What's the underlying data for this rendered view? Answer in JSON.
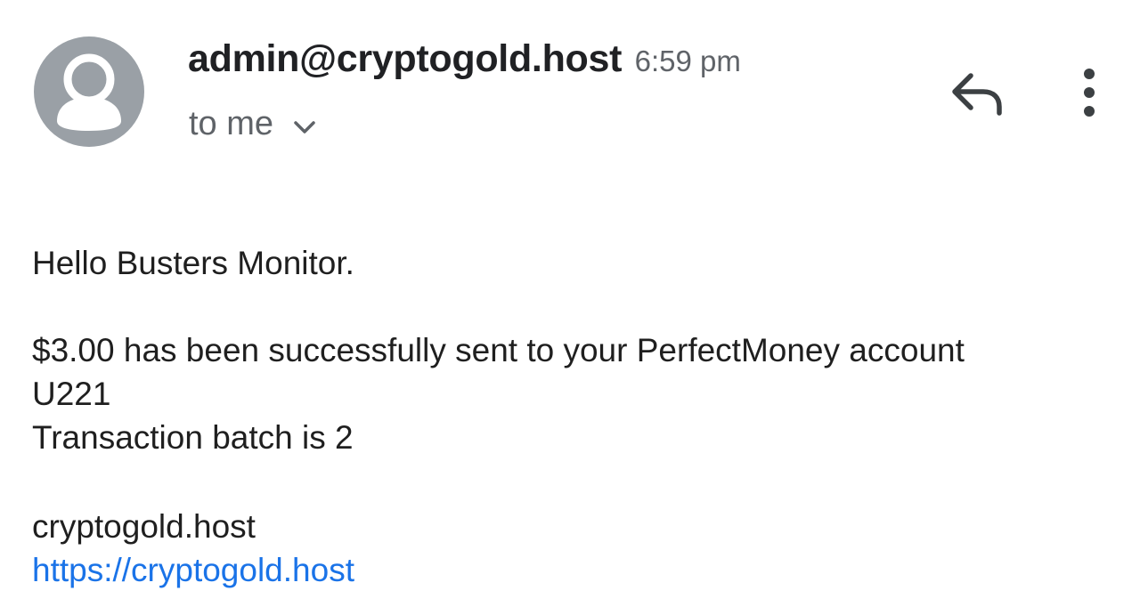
{
  "header": {
    "sender_email": "admin@cryptogold.host",
    "time": "6:59 pm",
    "recipient_label": "to me"
  },
  "icons": {
    "avatar": "person-avatar-icon",
    "expand": "chevron-down-icon",
    "reply": "reply-icon",
    "more": "more-vert-icon"
  },
  "colors": {
    "avatar_bg": "#9aa0a6",
    "link": "#1a73e8",
    "secondary_text": "#5f6368"
  },
  "message": {
    "greeting": "Hello Busters Monitor.",
    "sent_line": "$3.00 has been successfully sent to your PerfectMoney account",
    "account_line": "U221",
    "batch_line": "Transaction batch is 2",
    "site_name": "cryptogold.host",
    "site_link": "https://cryptogold.host"
  }
}
